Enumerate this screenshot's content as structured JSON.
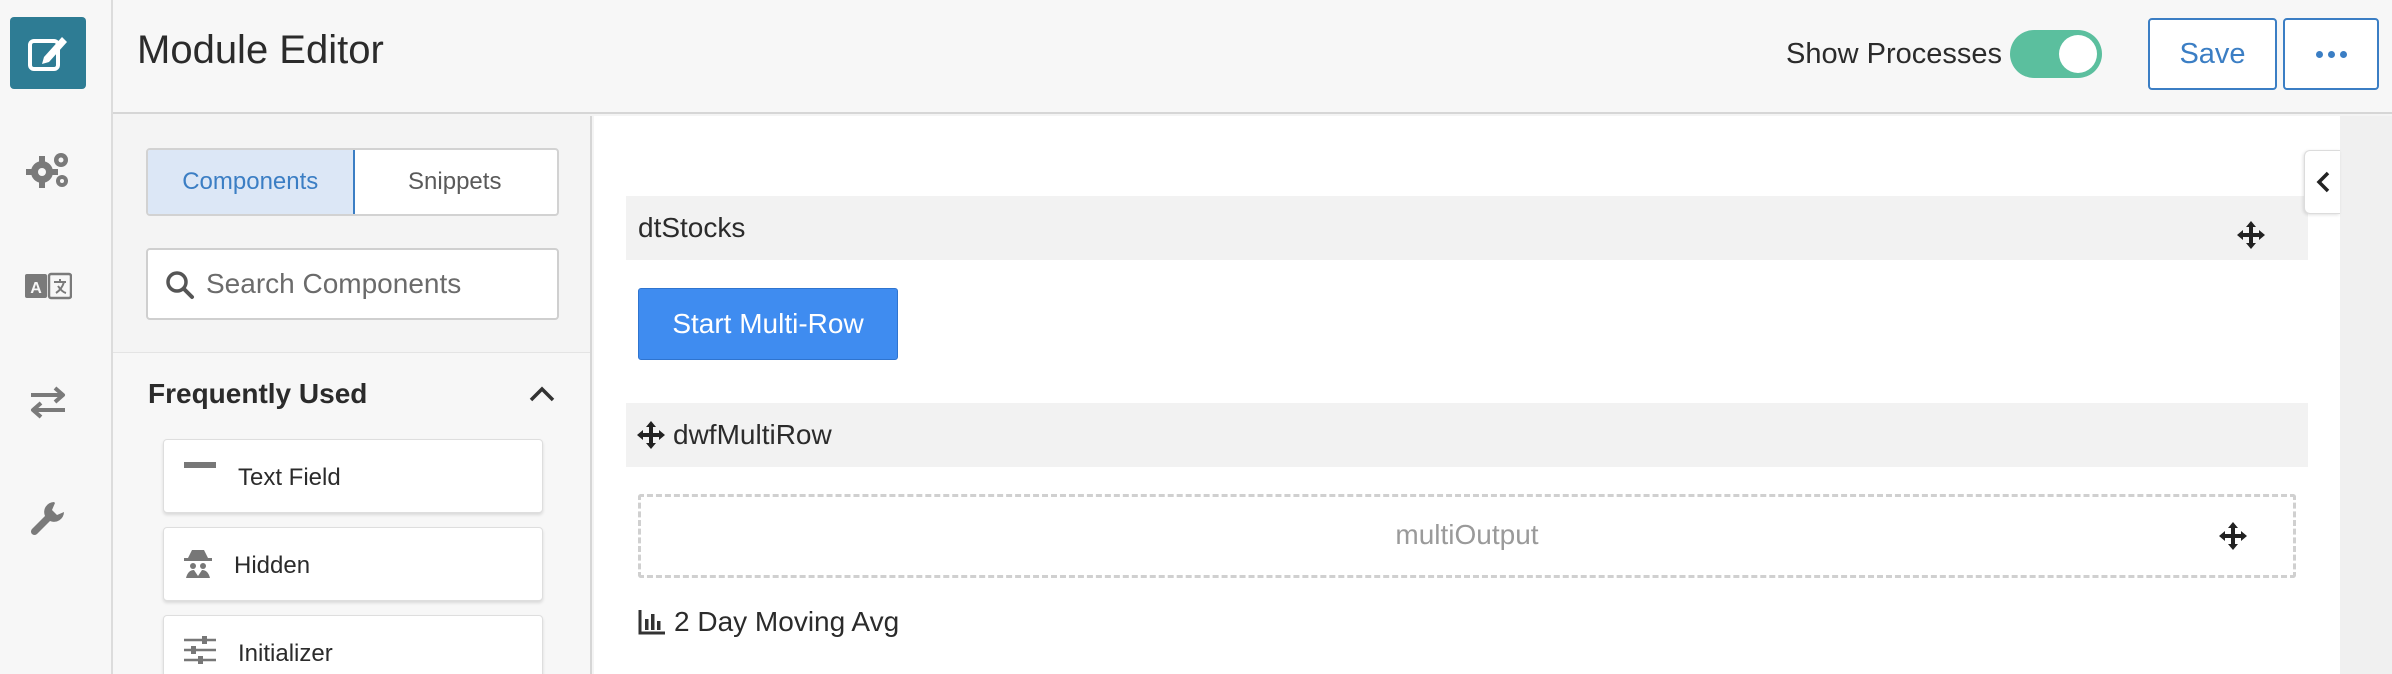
{
  "header": {
    "title": "Module Editor",
    "show_processes_label": "Show Processes",
    "show_processes_on": true,
    "save_label": "Save"
  },
  "rail": {
    "items": [
      {
        "icon": "edit-icon",
        "active": true
      },
      {
        "icon": "gears-icon"
      },
      {
        "icon": "translate-icon"
      },
      {
        "icon": "swap-arrows-icon"
      },
      {
        "icon": "wrench-icon"
      }
    ]
  },
  "panel": {
    "tabs": [
      {
        "label": "Components",
        "active": true
      },
      {
        "label": "Snippets",
        "active": false
      }
    ],
    "search_placeholder": "Search Components",
    "section_title": "Frequently Used",
    "items": [
      {
        "label": "Text Field",
        "icon": "text-field-icon"
      },
      {
        "label": "Hidden",
        "icon": "hidden-spy-icon"
      },
      {
        "label": "Initializer",
        "icon": "sliders-icon"
      }
    ]
  },
  "canvas": {
    "table_name": "dtStocks",
    "start_button": "Start Multi-Row",
    "multirow_name": "dwfMultiRow",
    "output_placeholder": "multiOutput",
    "chart_label": "2 Day Moving Avg"
  },
  "colors": {
    "accent": "#3b7ec4",
    "rail_active": "#2e7c94",
    "toggle_on": "#5bbf9e",
    "primary_button": "#3f8cf0"
  }
}
